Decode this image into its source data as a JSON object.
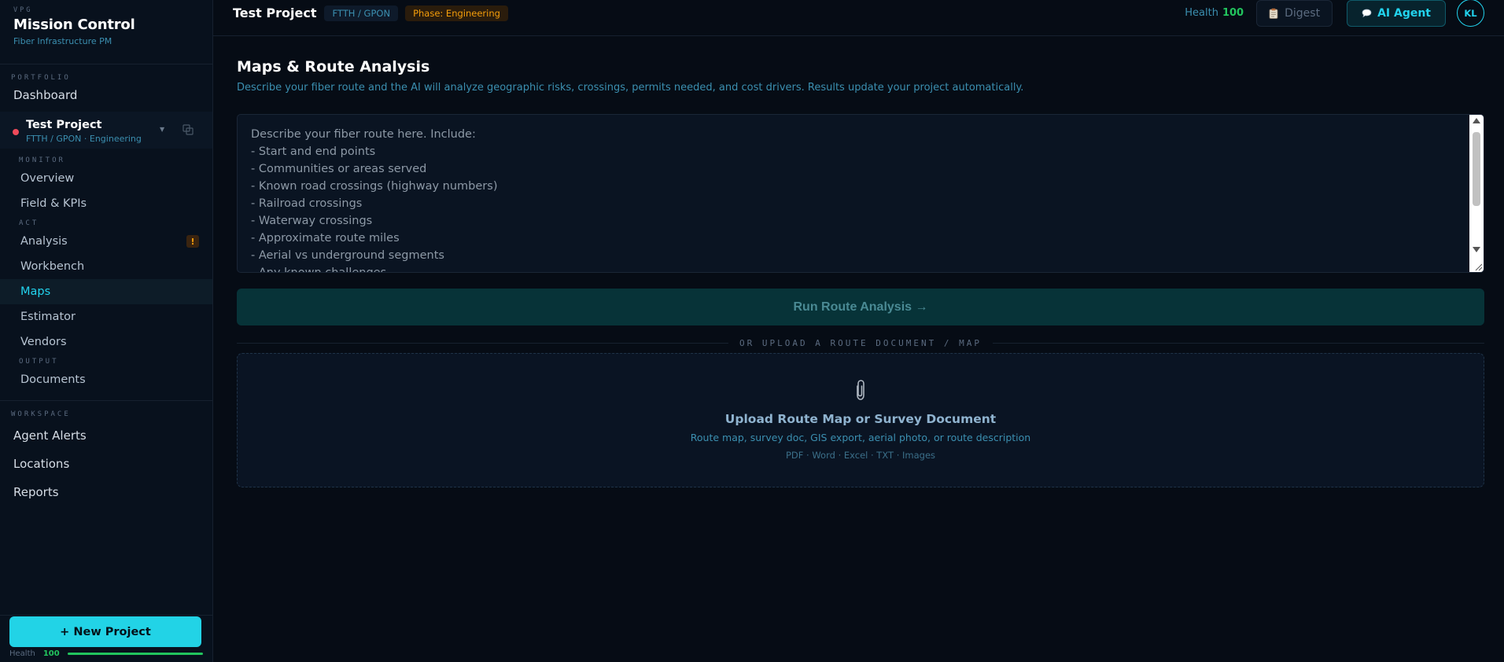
{
  "brand": {
    "tag": "VPG",
    "title": "Mission Control",
    "subtitle": "Fiber Infrastructure PM"
  },
  "sidebar": {
    "portfolio_label": "PORTFOLIO",
    "dashboard": "Dashboard",
    "project": {
      "name": "Test Project",
      "meta": "FTTH / GPON · Engineering",
      "status_color": "#ef4a5a"
    },
    "sections": {
      "monitor": "MONITOR",
      "act": "ACT",
      "output": "OUTPUT"
    },
    "items": {
      "overview": "Overview",
      "field_kpis": "Field & KPIs",
      "analysis": "Analysis",
      "analysis_badge": "!",
      "workbench": "Workbench",
      "maps": "Maps",
      "estimator": "Estimator",
      "vendors": "Vendors",
      "documents": "Documents"
    },
    "workspace_label": "WORKSPACE",
    "workspace": {
      "agent_alerts": "Agent Alerts",
      "locations": "Locations",
      "reports": "Reports"
    },
    "new_project": "+ New Project",
    "footer_health_label": "Health",
    "footer_health_value": "100",
    "footer_health_fraction": 1.0
  },
  "topbar": {
    "title": "Test Project",
    "tech_chip": "FTTH / GPON",
    "phase_chip": "Phase: Engineering",
    "health_label": "Health",
    "health_value": "100",
    "digest_label": "Digest",
    "agent_label": "AI Agent",
    "avatar_initials": "KL"
  },
  "main": {
    "title": "Maps & Route Analysis",
    "description": "Describe your fiber route and the AI will analyze geographic risks, crossings, permits needed, and cost drivers. Results update your project automatically.",
    "route_placeholder": "Describe your fiber route here. Include:\n- Start and end points\n- Communities or areas served\n- Known road crossings (highway numbers)\n- Railroad crossings\n- Waterway crossings\n- Approximate route miles\n- Aerial vs underground segments\n- Any known challenges",
    "run_button": "Run Route Analysis →",
    "divider_text": "OR UPLOAD A ROUTE DOCUMENT / MAP",
    "upload": {
      "title": "Upload Route Map or Survey Document",
      "subtitle": "Route map, survey doc, GIS export, aerial photo, or route description",
      "formats": "PDF · Word · Excel · TXT · Images"
    }
  },
  "colors": {
    "accent": "#22d3ee",
    "health_good": "#22c55e",
    "phase": "#f59e0b",
    "background": "#060c15"
  }
}
